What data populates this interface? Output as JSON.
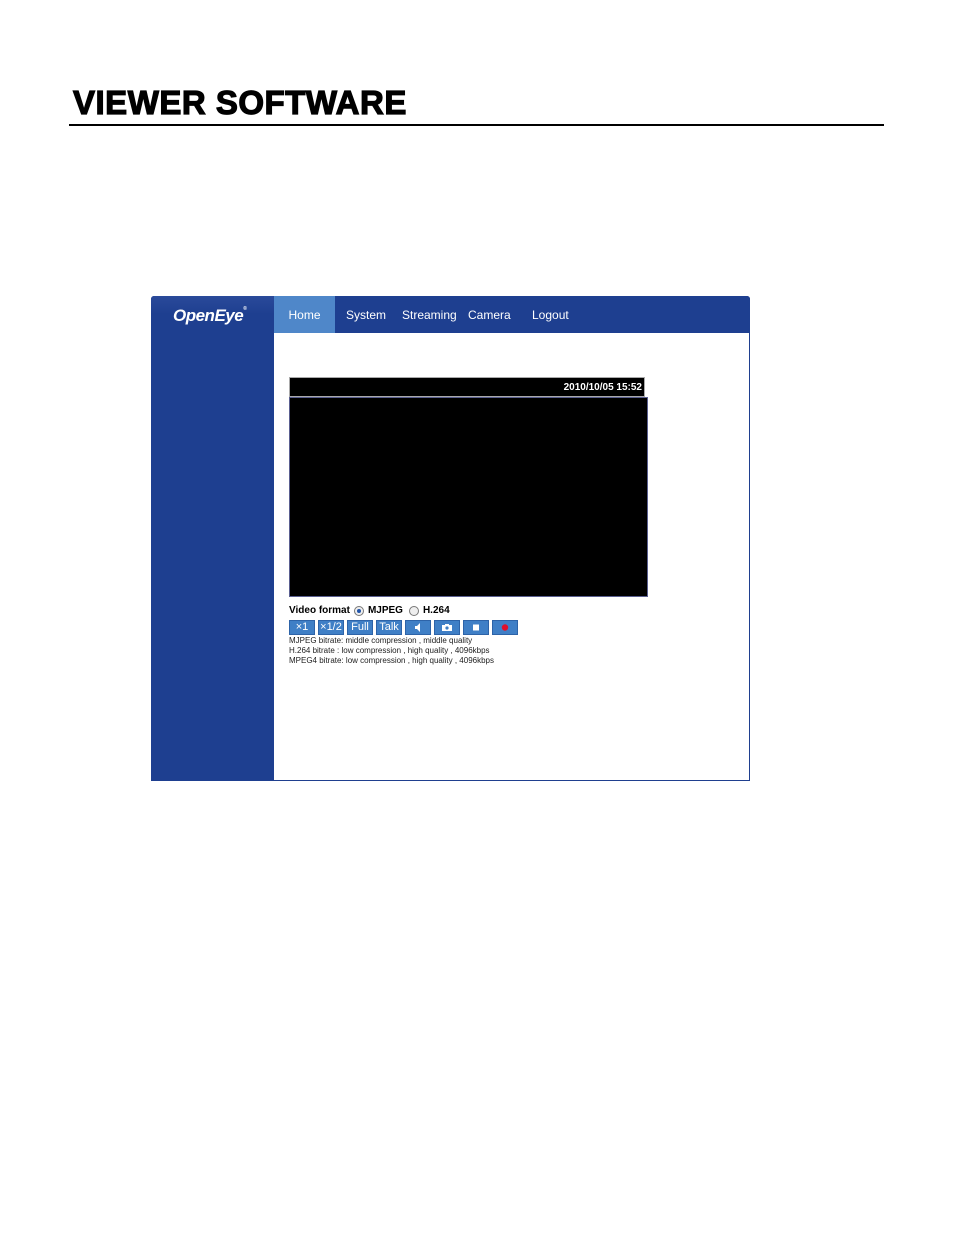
{
  "document": {
    "title": "VIEWER SOFTWARE"
  },
  "app": {
    "logo": "OpenEye",
    "nav": [
      {
        "label": "Home",
        "active": true
      },
      {
        "label": "System"
      },
      {
        "label": "Streaming"
      },
      {
        "label": "Camera"
      },
      {
        "label": "Logout"
      }
    ],
    "video": {
      "timestamp": "2010/10/05 15:52"
    },
    "video_format": {
      "label": "Video format",
      "options": [
        "MJPEG",
        "H.264"
      ],
      "selected": "MJPEG"
    },
    "buttons": [
      {
        "label": "×1",
        "icon": null
      },
      {
        "label": "×1/2",
        "icon": null
      },
      {
        "label": "Full",
        "icon": null
      },
      {
        "label": "Talk",
        "icon": null
      },
      {
        "label": "",
        "icon": "speaker-icon"
      },
      {
        "label": "",
        "icon": "camera-icon"
      },
      {
        "label": "",
        "icon": "stop-icon"
      },
      {
        "label": "",
        "icon": "record-icon"
      }
    ],
    "info_lines": [
      "MJPEG bitrate: middle compression , middle quality",
      "H.264 bitrate  : low compression , high quality , 4096kbps",
      "MPEG4 bitrate: low compression , high quality , 4096kbps"
    ]
  }
}
